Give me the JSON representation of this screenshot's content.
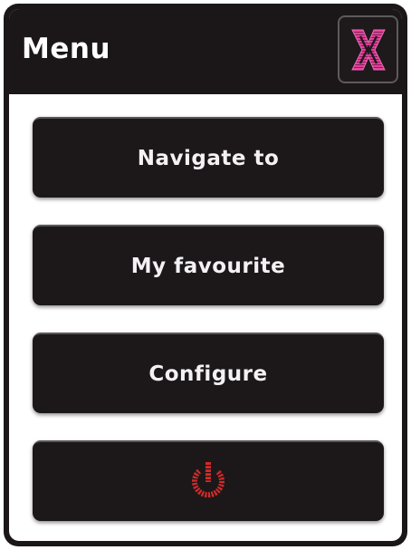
{
  "header": {
    "title": "Menu",
    "close_icon": "close-x-icon",
    "close_color": "#e0409a"
  },
  "menu": {
    "items": [
      {
        "label": "Navigate to"
      },
      {
        "label": "My favourite"
      },
      {
        "label": "Configure"
      }
    ],
    "power": {
      "icon": "power-icon",
      "color": "#d42a2a"
    }
  }
}
